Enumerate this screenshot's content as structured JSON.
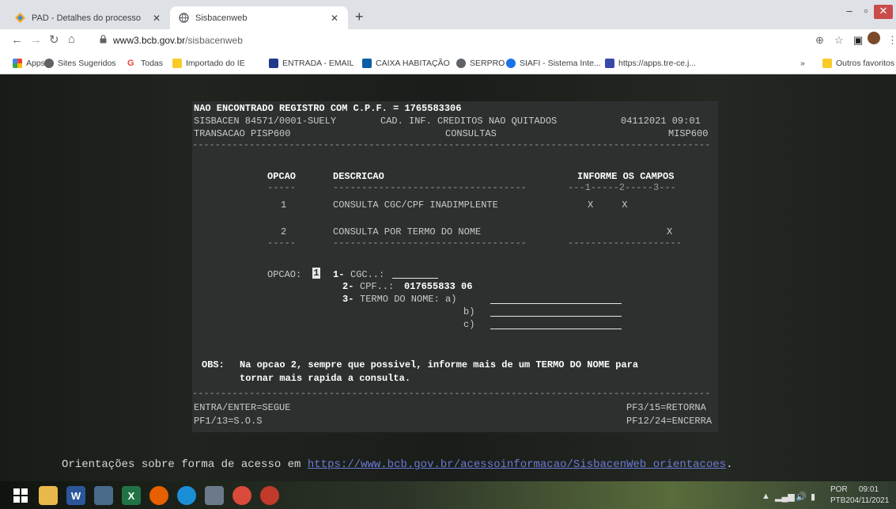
{
  "browser": {
    "tabs": [
      {
        "title": "PAD - Detalhes do processo",
        "active": false
      },
      {
        "title": "Sisbacenweb",
        "active": true
      }
    ],
    "url_host": "www3.bcb.gov.br",
    "url_path": "/sisbacenweb",
    "bookmarks": [
      {
        "label": "Apps",
        "color": "#4285f4"
      },
      {
        "label": "Sites Sugeridos",
        "color": "#5f6368"
      },
      {
        "label": "Todas",
        "color": "#ea4335"
      },
      {
        "label": "Importado do IE",
        "color": "#f9cb28"
      },
      {
        "label": "ENTRADA - EMAIL",
        "color": "#1e3a8a"
      },
      {
        "label": "CAIXA HABITAÇÃO",
        "color": "#0b5fa5"
      },
      {
        "label": "SERPRO",
        "color": "#5f6368"
      },
      {
        "label": "SIAFI - Sistema Inte...",
        "color": "#1a73e8"
      },
      {
        "label": "https://apps.tre-ce.j...",
        "color": "#3949ab"
      }
    ],
    "more_bookmarks": "»",
    "other_favorites": "Outros favoritos"
  },
  "terminal": {
    "message": "NAO ENCONTRADO REGISTRO COM C.P.F. = 1765583306",
    "header_left": "SISBACEN 84571/0001-SUELY",
    "header_center": "CAD. INF. CREDITOS NAO QUITADOS",
    "header_datetime": "04112021 09:01",
    "transaction": "TRANSACAO PISP600",
    "section": "CONSULTAS",
    "screen_id": "MISP600",
    "col_opcao": "OPCAO",
    "col_descricao": "DESCRICAO",
    "col_informe": "INFORME OS CAMPOS",
    "col_fields_ruler": "---1-----2-----3---",
    "options": [
      {
        "num": "1",
        "desc": "CONSULTA CGC/CPF INADIMPLENTE",
        "marks": "X     X"
      },
      {
        "num": "2",
        "desc": "CONSULTA POR TERMO DO NOME",
        "marks": "X"
      }
    ],
    "opcao_label": "OPCAO:",
    "opcao_value": "1",
    "field_cgc_num": "1-",
    "field_cgc_label": "CGC..:",
    "field_cpf_num": "2-",
    "field_cpf_label": "CPF..:",
    "field_cpf_value": "017655833 06",
    "field_termo_num": "3-",
    "field_termo_label": "TERMO DO NOME: a)",
    "field_termo_b": "b)",
    "field_termo_c": "c)",
    "obs_label": "OBS:",
    "obs_line1": "Na opcao 2, sempre que possivel, informe mais de um TERMO DO NOME para",
    "obs_line2": "tornar mais rapida a consulta.",
    "key_enter": "ENTRA/ENTER=SEGUE",
    "key_pf1": "PF1/13=S.O.S",
    "key_pf3": "PF3/15=RETORNA",
    "key_pf12": "PF12/24=ENCERRA"
  },
  "footer": {
    "text": "Orientações sobre forma de acesso em ",
    "link": "https://www.bcb.gov.br/acessoinformacao/SisbacenWeb_orientacoes",
    "suffix": "."
  },
  "taskbar": {
    "lang": "POR",
    "layout": "PTB2",
    "time": "09:01",
    "date": "04/11/2021"
  }
}
